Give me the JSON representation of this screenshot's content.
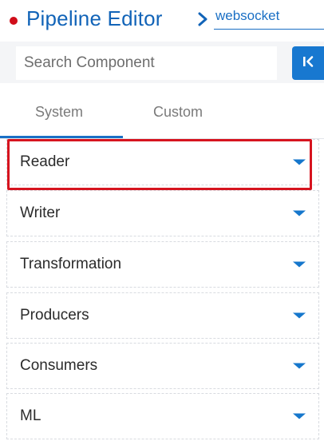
{
  "header": {
    "title": "Pipeline Editor",
    "chevron_icon": "chevron-right-icon",
    "pipeline_name": "websocket",
    "status_dot_color": "#d00d1a",
    "accent_color": "#1264b8"
  },
  "search": {
    "placeholder": "Search Component",
    "value": "",
    "collapse_icon": "collapse-left-icon"
  },
  "tabs": [
    {
      "label": "System",
      "active": true
    },
    {
      "label": "Custom",
      "active": false
    }
  ],
  "components": [
    {
      "label": "Reader",
      "highlighted": true,
      "icon": "caret-down-icon"
    },
    {
      "label": "Writer",
      "highlighted": false,
      "icon": "caret-down-icon"
    },
    {
      "label": "Transformation",
      "highlighted": false,
      "icon": "caret-down-icon"
    },
    {
      "label": "Producers",
      "highlighted": false,
      "icon": "caret-down-icon"
    },
    {
      "label": "Consumers",
      "highlighted": false,
      "icon": "caret-down-icon"
    },
    {
      "label": "ML",
      "highlighted": false,
      "icon": "caret-down-icon"
    }
  ],
  "highlight_color": "#d6141f"
}
